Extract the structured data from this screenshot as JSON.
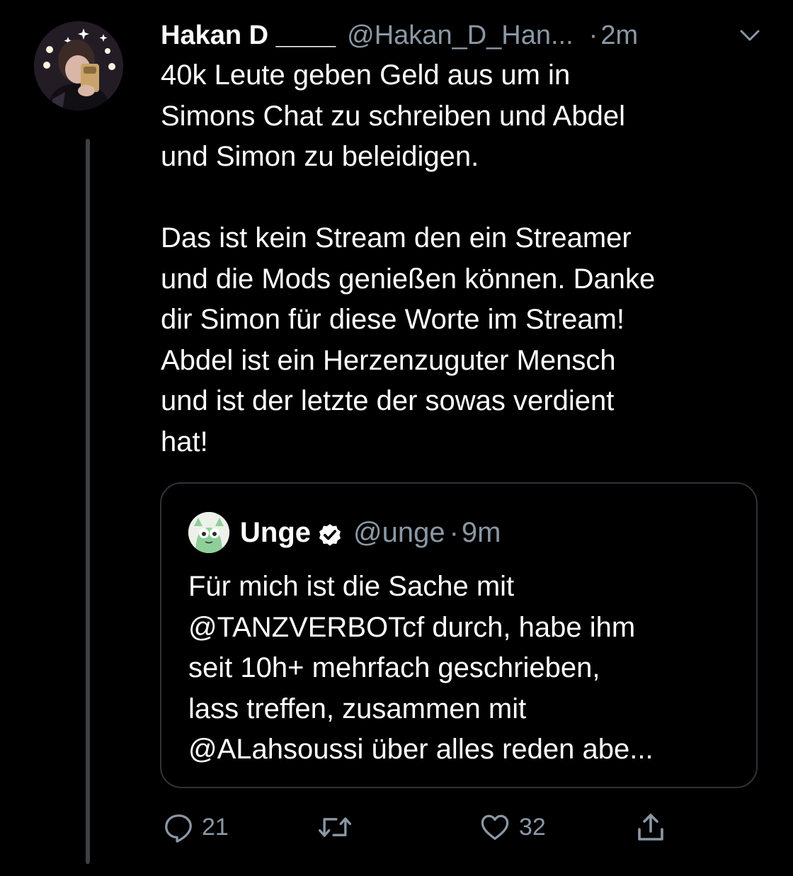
{
  "tweet": {
    "display_name": "Hakan D ____",
    "handle": "@Hakan_D_Han...",
    "dot": "·",
    "time": "2m",
    "text": "40k Leute geben Geld aus um in\nSimons Chat zu schreiben und Abdel\nund Simon zu beleidigen.\n\nDas ist kein Stream den ein Streamer\nund die Mods genießen können. Danke\ndir Simon für diese Worte im Stream!\nAbdel ist ein Herzenzuguter Mensch\nund ist der letzte der sowas verdient\nhat!"
  },
  "quote": {
    "display_name": "Unge",
    "handle": "@unge",
    "dot": "·",
    "time": "9m",
    "text": "Für mich ist die Sache mit\n@TANZVERBOTcf durch, habe ihm\nseit 10h+ mehrfach geschrieben,\nlass treffen, zusammen mit\n@ALahsoussi über alles reden abe..."
  },
  "actions": {
    "reply_count": "21",
    "retweet_count": "",
    "like_count": "32"
  },
  "icons": {
    "caret": "chevron-down-icon",
    "verified": "verified-badge-icon",
    "reply": "reply-icon",
    "retweet": "retweet-icon",
    "like": "heart-icon",
    "share": "share-icon"
  },
  "colors": {
    "background": "#000000",
    "text": "#ffffff",
    "secondary": "#8b98a5",
    "border": "#2f3336",
    "thread_line": "#3d4144"
  }
}
